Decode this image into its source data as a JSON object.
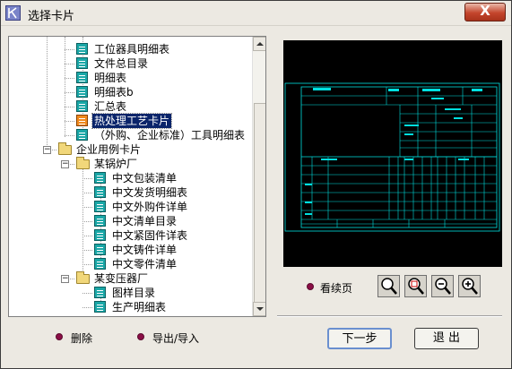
{
  "window": {
    "title": "选择卡片",
    "close_label": "X"
  },
  "tree": {
    "items": [
      {
        "label": "工位器具明细表",
        "type": "doc"
      },
      {
        "label": "文件总目录",
        "type": "doc"
      },
      {
        "label": "明细表",
        "type": "doc"
      },
      {
        "label": "明细表b",
        "type": "doc"
      },
      {
        "label": "汇总表",
        "type": "doc"
      },
      {
        "label": "热处理工艺卡片",
        "type": "doc-hot",
        "selected": true
      },
      {
        "label": "（外购、企业标准）工具明细表",
        "type": "doc"
      },
      {
        "label": "企业用例卡片",
        "type": "folder",
        "expanded": true
      },
      {
        "label": "某锅炉厂",
        "type": "folder",
        "expanded": true
      },
      {
        "label": "中文包装清单",
        "type": "doc"
      },
      {
        "label": "中文发货明细表",
        "type": "doc"
      },
      {
        "label": "中文外购件详单",
        "type": "doc"
      },
      {
        "label": "中文清单目录",
        "type": "doc"
      },
      {
        "label": "中文紧固件详表",
        "type": "doc"
      },
      {
        "label": "中文铸件详单",
        "type": "doc"
      },
      {
        "label": "中文零件清单",
        "type": "doc"
      },
      {
        "label": "某变压器厂",
        "type": "folder",
        "expanded": true
      },
      {
        "label": "图样目录",
        "type": "doc"
      },
      {
        "label": "生产明细表",
        "type": "doc"
      }
    ]
  },
  "actions": {
    "delete_label": "删除",
    "export_import_label": "导出/导入",
    "view_continuation_label": "看续页"
  },
  "buttons": {
    "next_label": "下一步",
    "exit_label": "退 出"
  },
  "zoom_tools": [
    "zoom-fit-icon",
    "zoom-window-icon",
    "zoom-out-icon",
    "zoom-in-icon"
  ],
  "colors": {
    "selection": "#0a246a",
    "preview_bg": "#000000",
    "preview_lines": "#00e0e0",
    "bullet": "#8b0e46"
  }
}
